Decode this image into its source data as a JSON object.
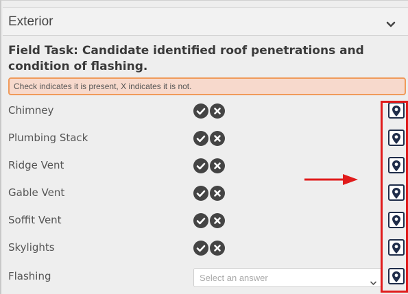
{
  "section": {
    "title": "Exterior",
    "toggle_icon": "chevron-down-icon"
  },
  "task": {
    "title": "Field Task: Candidate identified roof penetrations and condition of flashing."
  },
  "note": {
    "text": "Check indicates it is present, X indicates it is not."
  },
  "rows": [
    {
      "label": "Chimney",
      "type": "checkx"
    },
    {
      "label": "Plumbing Stack",
      "type": "checkx"
    },
    {
      "label": "Ridge Vent",
      "type": "checkx"
    },
    {
      "label": "Gable Vent",
      "type": "checkx"
    },
    {
      "label": "Soffit Vent",
      "type": "checkx"
    },
    {
      "label": "Skylights",
      "type": "checkx"
    },
    {
      "label": "Flashing",
      "type": "select"
    }
  ],
  "flashing_select": {
    "placeholder": "Select an answer"
  },
  "colors": {
    "note_border": "#f09a5a",
    "note_bg": "#f7d9cc",
    "highlight": "#e01b1b",
    "pin": "#1f2d4a",
    "icon_bg": "#444444"
  },
  "icons": {
    "check": "check-circle-icon",
    "x": "x-circle-icon",
    "pin": "map-pin-icon",
    "arrow": "red-arrow-right"
  }
}
